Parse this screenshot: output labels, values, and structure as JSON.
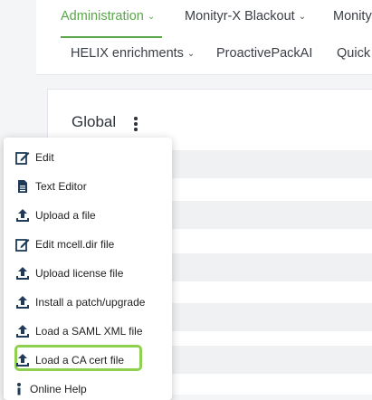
{
  "nav": {
    "row1": [
      {
        "label": "Administration",
        "active": true
      },
      {
        "label": "Monityr-X Blackout",
        "active": false
      },
      {
        "label": "Monity",
        "active": false
      }
    ],
    "row2": [
      {
        "label": "HELIX enrichments"
      },
      {
        "label": "ProactivePackAI"
      },
      {
        "label": "Quick"
      }
    ]
  },
  "panel": {
    "title": "Global"
  },
  "menu": {
    "items": [
      {
        "label": "Edit",
        "icon": "edit-icon"
      },
      {
        "label": "Text Editor",
        "icon": "document-icon"
      },
      {
        "label": "Upload a file",
        "icon": "upload-icon"
      },
      {
        "label": "Edit mcell.dir file",
        "icon": "edit-icon"
      },
      {
        "label": "Upload license file",
        "icon": "upload-icon"
      },
      {
        "label": "Install a patch/upgrade",
        "icon": "upload-icon"
      },
      {
        "label": "Load a SAML XML file",
        "icon": "upload-icon"
      },
      {
        "label": "Load a CA cert file",
        "icon": "upload-icon",
        "highlighted": true
      },
      {
        "label": "Online Help",
        "icon": "info-icon"
      }
    ]
  },
  "colors": {
    "accent": "#5aa64a",
    "highlight": "#8dd14f",
    "icon": "#1f3b57"
  }
}
